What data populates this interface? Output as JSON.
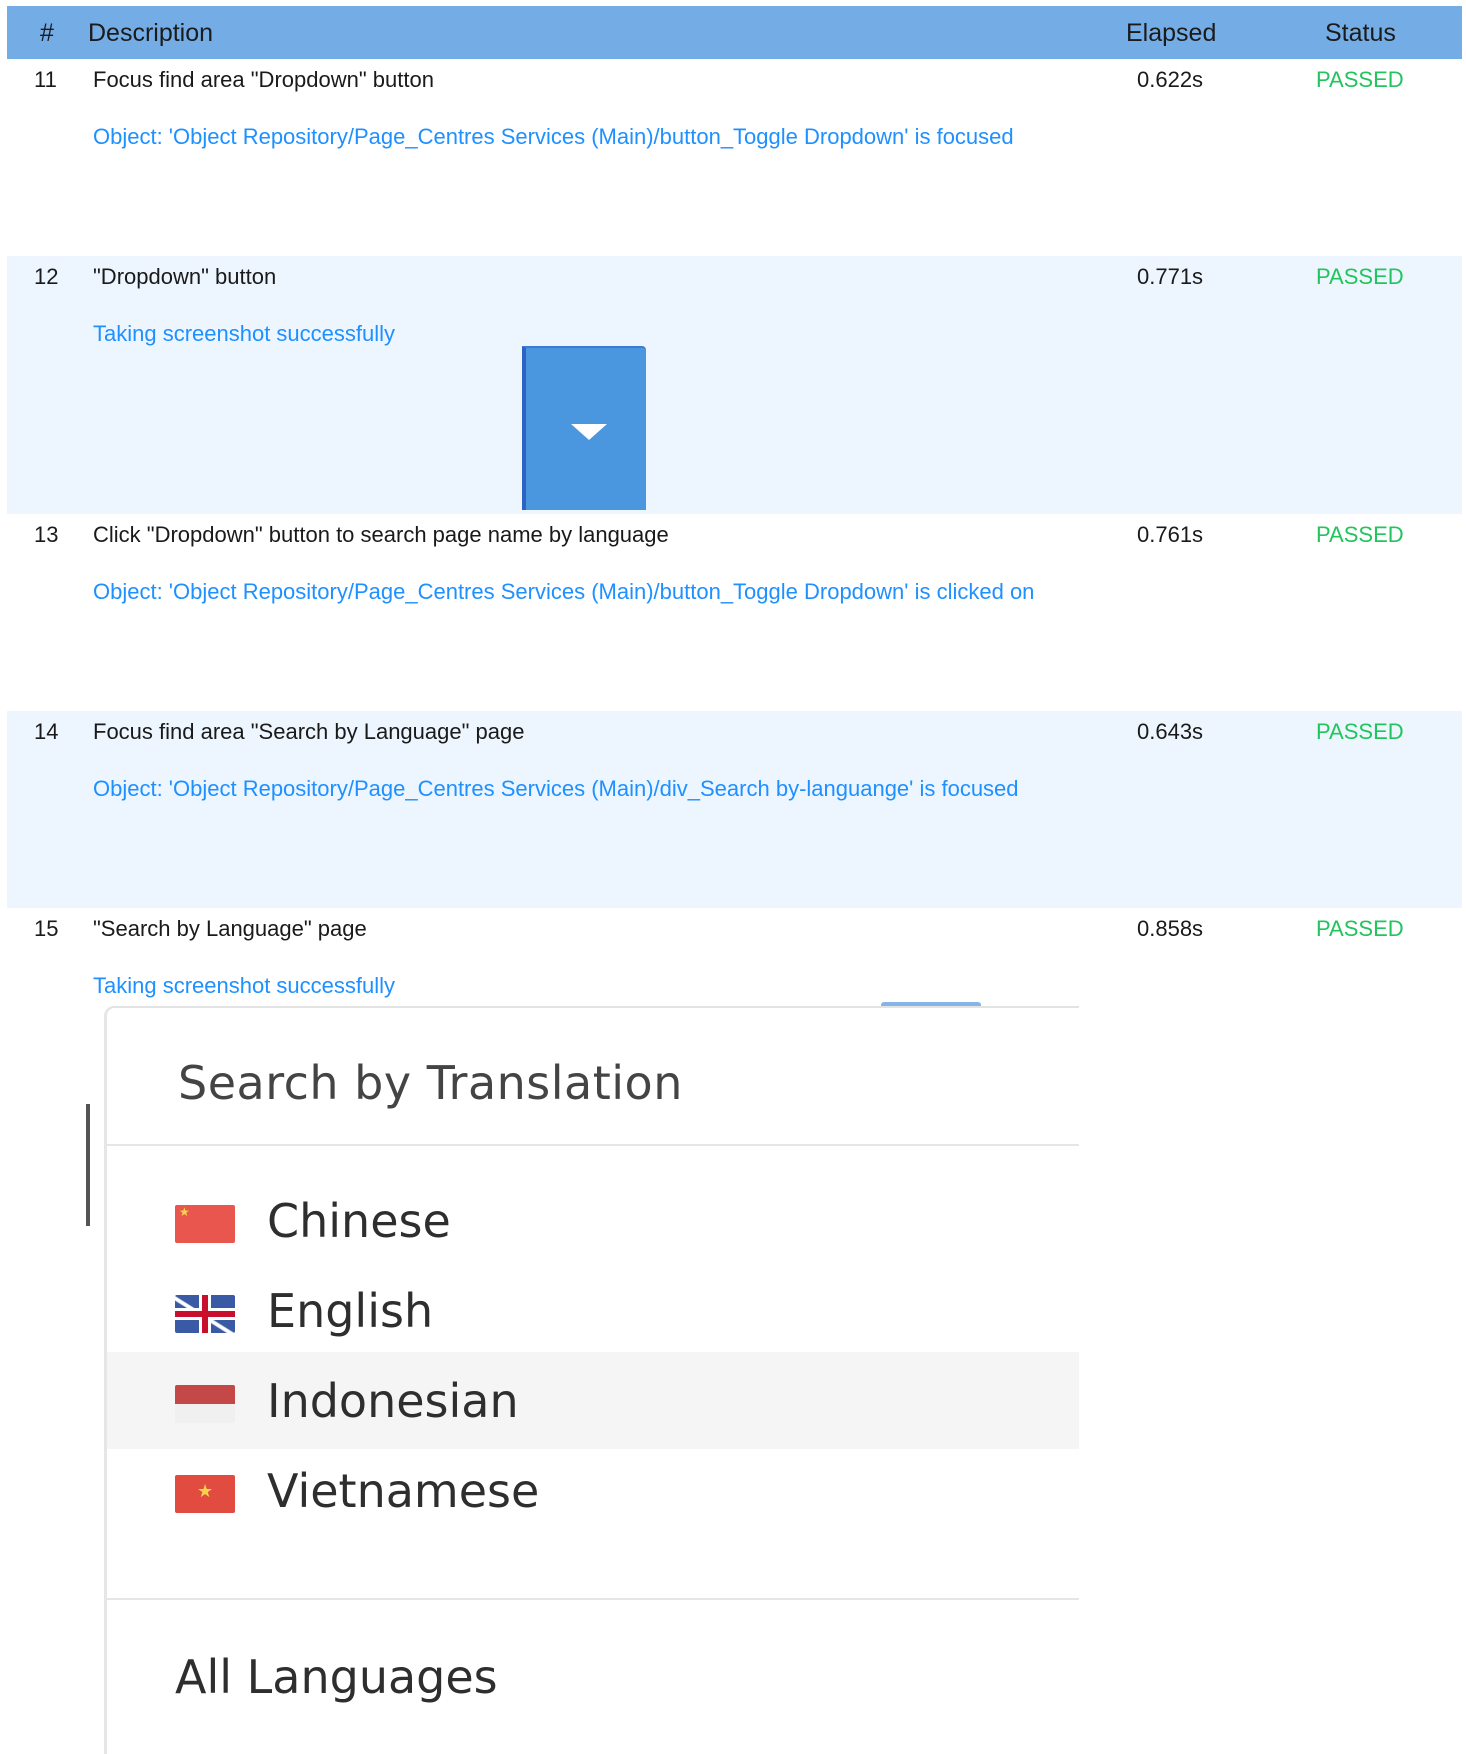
{
  "table": {
    "headers": {
      "num": "#",
      "description": "Description",
      "elapsed": "Elapsed",
      "status": "Status"
    },
    "rows": [
      {
        "num": "11",
        "description": "Focus find area \"Dropdown\" button",
        "elapsed": "0.622s",
        "status": "PASSED",
        "log": "Object: 'Object Repository/Page_Centres  Services (Main)/button_Toggle Dropdown' is focused"
      },
      {
        "num": "12",
        "description": "\"Dropdown\" button",
        "elapsed": "0.771s",
        "status": "PASSED",
        "log": "Taking screenshot successfully"
      },
      {
        "num": "13",
        "description": "Click \"Dropdown\" button to search page name by language",
        "elapsed": "0.761s",
        "status": "PASSED",
        "log": "Object: 'Object Repository/Page_Centres  Services (Main)/button_Toggle Dropdown' is clicked on"
      },
      {
        "num": "14",
        "description": "Focus find area \"Search by Language\" page",
        "elapsed": "0.643s",
        "status": "PASSED",
        "log": "Object: 'Object Repository/Page_Centres  Services (Main)/div_Search by-languange' is focused"
      },
      {
        "num": "15",
        "description": "\"Search by Language\" page",
        "elapsed": "0.858s",
        "status": "PASSED",
        "log": "Taking screenshot successfully"
      }
    ]
  },
  "language_menu": {
    "title": "Search by Translation",
    "languages": [
      "Chinese",
      "English",
      "Indonesian",
      "Vietnamese"
    ],
    "hovered": "Indonesian",
    "all_label": "All Languages"
  },
  "colors": {
    "header_bg": "#74ade6",
    "alt_row_bg": "#edf6ff",
    "log_text": "#1e90ff",
    "passed": "#22c45d",
    "dropdown_button": "#4a97e0"
  },
  "icons": [
    "caret-down-icon",
    "china-flag-icon",
    "uk-flag-icon",
    "indonesia-flag-icon",
    "vietnam-flag-icon"
  ]
}
